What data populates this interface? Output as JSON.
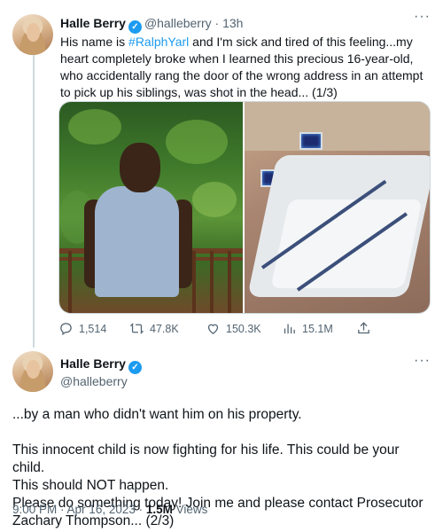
{
  "tweet1": {
    "name": "Halle Berry",
    "handle": "@halleberry",
    "time": "13h",
    "text_before_tag": "His name is ",
    "hashtag": "#RalphYarl",
    "text_after_tag": " and I'm sick and tired of this feeling...my heart completely broke when I learned this precious 16-year-old, who accidentally rang the door of the wrong address in an attempt to pick up his siblings, was shot in the head... (1/3)",
    "stats": {
      "replies": "1,514",
      "retweets": "47.8K",
      "likes": "150.3K",
      "views": "15.1M"
    }
  },
  "tweet2": {
    "name": "Halle Berry",
    "handle": "@halleberry",
    "lines": [
      "...by a man who didn't want him on his property.",
      "",
      "This innocent child is now fighting for his life. This could be your child.",
      "This should NOT happen.",
      "Please do something today! Join me and please contact Prosecutor",
      "Zachary Thompson... (2/3)"
    ],
    "time": "9:00 PM",
    "date": "Apr 16, 2023",
    "views_count": "1.5M",
    "views_label": "Views"
  },
  "icons": {
    "verified": "verified-badge-icon",
    "more": "more-horizontal-icon",
    "reply": "reply-icon",
    "retweet": "retweet-icon",
    "like": "heart-icon",
    "views": "bar-chart-icon",
    "share": "share-icon"
  },
  "colors": {
    "accent": "#1d9bf0",
    "muted": "#536471",
    "text": "#0f1419"
  }
}
